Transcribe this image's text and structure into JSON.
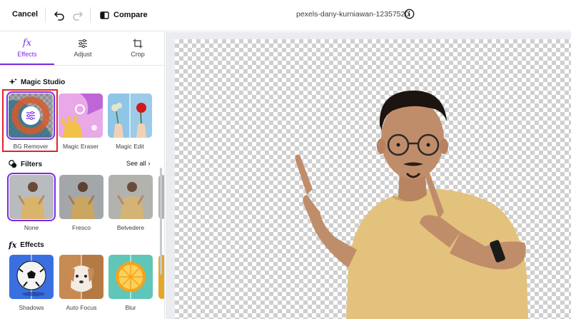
{
  "topbar": {
    "cancel_label": "Cancel",
    "undo_icon": "undo-icon",
    "redo_icon": "redo-icon",
    "compare_label": "Compare",
    "filename": "pexels-dany-kurniawan-12357520",
    "info_icon": "info-icon"
  },
  "tabs": [
    {
      "label": "Effects",
      "icon": "fx-icon",
      "active": true
    },
    {
      "label": "Adjust",
      "icon": "sliders-icon",
      "active": false
    },
    {
      "label": "Crop",
      "icon": "crop-icon",
      "active": false
    }
  ],
  "magic_studio": {
    "title": "Magic Studio",
    "items": [
      {
        "label": "BG Remover",
        "selected": true
      },
      {
        "label": "Magic Eraser",
        "selected": false
      },
      {
        "label": "Magic Edit",
        "selected": false
      }
    ]
  },
  "filters": {
    "title": "Filters",
    "see_all": "See all",
    "items": [
      {
        "label": "None",
        "selected": true
      },
      {
        "label": "Fresco",
        "selected": false
      },
      {
        "label": "Belvedere",
        "selected": false
      }
    ]
  },
  "effects": {
    "title": "Effects",
    "items": [
      {
        "label": "Shadows"
      },
      {
        "label": "Auto Focus"
      },
      {
        "label": "Blur"
      }
    ]
  },
  "colors": {
    "accent": "#7d2ae8",
    "highlight": "#e0242a",
    "shirt": "#e3c27d"
  }
}
